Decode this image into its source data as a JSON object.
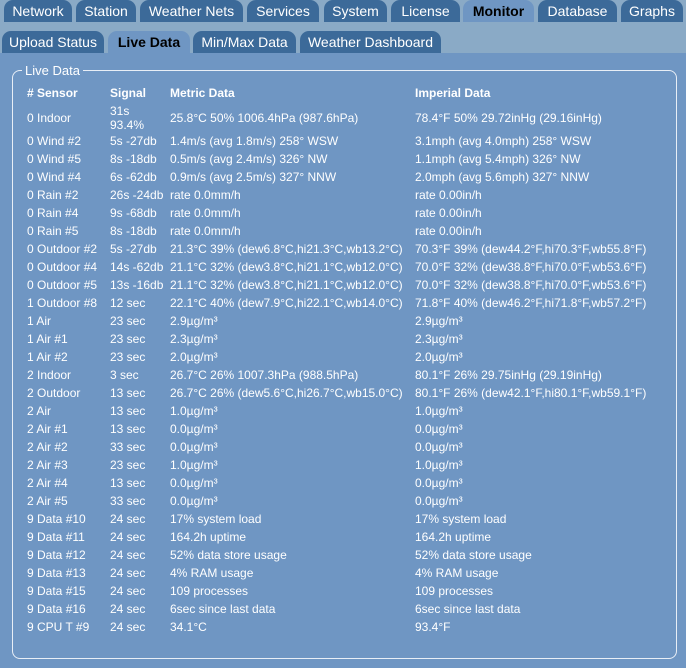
{
  "main_tabs": [
    {
      "label": "Network",
      "active": false
    },
    {
      "label": "Station",
      "active": false
    },
    {
      "label": "Weather Nets",
      "active": false
    },
    {
      "label": "Services",
      "active": false
    },
    {
      "label": "System",
      "active": false
    },
    {
      "label": "License",
      "active": false
    },
    {
      "label": "Monitor",
      "active": true
    },
    {
      "label": "Database",
      "active": false
    },
    {
      "label": "Graphs",
      "active": false
    }
  ],
  "sub_tabs": [
    {
      "label": "Upload Status",
      "active": false
    },
    {
      "label": "Live Data",
      "active": true
    },
    {
      "label": "Min/Max Data",
      "active": false
    },
    {
      "label": "Weather Dashboard",
      "active": false
    }
  ],
  "panel": {
    "legend": "Live Data"
  },
  "table": {
    "headers": [
      "# Sensor",
      "Signal",
      "Metric Data",
      "Imperial Data"
    ],
    "rows": [
      [
        "0 Indoor",
        "31s\n93.4%",
        "25.8°C 50% 1006.4hPa (987.6hPa)",
        "78.4°F 50% 29.72inHg (29.16inHg)"
      ],
      [
        "0 Wind #2",
        "5s -27db",
        "1.4m/s (avg 1.8m/s) 258° WSW",
        "3.1mph (avg 4.0mph) 258° WSW"
      ],
      [
        "0 Wind #5",
        "8s -18db",
        "0.5m/s (avg 2.4m/s) 326° NW",
        "1.1mph (avg 5.4mph) 326° NW"
      ],
      [
        "0 Wind #4",
        "6s -62db",
        "0.9m/s (avg 2.5m/s) 327° NNW",
        "2.0mph (avg 5.6mph) 327° NNW"
      ],
      [
        "0 Rain #2",
        "26s -24db",
        "rate 0.0mm/h",
        "rate 0.00in/h"
      ],
      [
        "0 Rain #4",
        "9s -68db",
        "rate 0.0mm/h",
        "rate 0.00in/h"
      ],
      [
        "0 Rain #5",
        "8s -18db",
        "rate 0.0mm/h",
        "rate 0.00in/h"
      ],
      [
        "0 Outdoor #2",
        "5s -27db",
        "21.3°C 39% (dew6.8°C,hi21.3°C,wb13.2°C)",
        "70.3°F 39% (dew44.2°F,hi70.3°F,wb55.8°F)"
      ],
      [
        "0 Outdoor #4",
        "14s -62db",
        "21.1°C 32% (dew3.8°C,hi21.1°C,wb12.0°C)",
        "70.0°F 32% (dew38.8°F,hi70.0°F,wb53.6°F)"
      ],
      [
        "0 Outdoor #5",
        "13s -16db",
        "21.1°C 32% (dew3.8°C,hi21.1°C,wb12.0°C)",
        "70.0°F 32% (dew38.8°F,hi70.0°F,wb53.6°F)"
      ],
      [
        "1 Outdoor #8",
        "12 sec",
        "22.1°C 40% (dew7.9°C,hi22.1°C,wb14.0°C)",
        "71.8°F 40% (dew46.2°F,hi71.8°F,wb57.2°F)"
      ],
      [
        "1 Air",
        "23 sec",
        "2.9µg/m³",
        "2.9µg/m³"
      ],
      [
        "1 Air #1",
        "23 sec",
        "2.3µg/m³",
        "2.3µg/m³"
      ],
      [
        "1 Air #2",
        "23 sec",
        "2.0µg/m³",
        "2.0µg/m³"
      ],
      [
        "2 Indoor",
        "3 sec",
        "26.7°C 26% 1007.3hPa (988.5hPa)",
        "80.1°F 26% 29.75inHg (29.19inHg)"
      ],
      [
        "2 Outdoor",
        "13 sec",
        "26.7°C 26% (dew5.6°C,hi26.7°C,wb15.0°C)",
        "80.1°F 26% (dew42.1°F,hi80.1°F,wb59.1°F)"
      ],
      [
        "2 Air",
        "13 sec",
        "1.0µg/m³",
        "1.0µg/m³"
      ],
      [
        "2 Air #1",
        "13 sec",
        "0.0µg/m³",
        "0.0µg/m³"
      ],
      [
        "2 Air #2",
        "33 sec",
        "0.0µg/m³",
        "0.0µg/m³"
      ],
      [
        "2 Air #3",
        "23 sec",
        "1.0µg/m³",
        "1.0µg/m³"
      ],
      [
        "2 Air #4",
        "13 sec",
        "0.0µg/m³",
        "0.0µg/m³"
      ],
      [
        "2 Air #5",
        "33 sec",
        "0.0µg/m³",
        "0.0µg/m³"
      ],
      [
        "9 Data #10",
        "24 sec",
        "17% system load",
        "17% system load"
      ],
      [
        "9 Data #11",
        "24 sec",
        "164.2h uptime",
        "164.2h uptime"
      ],
      [
        "9 Data #12",
        "24 sec",
        "52% data store usage",
        "52% data store usage"
      ],
      [
        "9 Data #13",
        "24 sec",
        "4% RAM usage",
        "4% RAM usage"
      ],
      [
        "9 Data #15",
        "24 sec",
        "109 processes",
        "109 processes"
      ],
      [
        "9 Data #16",
        "24 sec",
        "6sec since last data",
        "6sec since last data"
      ],
      [
        "9 CPU T #9",
        "24 sec",
        "34.1°C",
        "93.4°F"
      ]
    ]
  },
  "colors": {
    "background": "#6f96c3",
    "tab": "#3c6a99",
    "tabbar": "#8aaac6"
  }
}
